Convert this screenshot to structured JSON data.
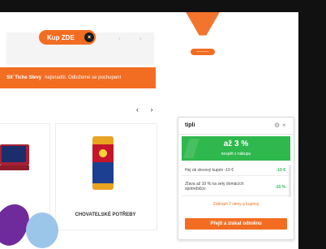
{
  "store": {
    "buy_button": "Kup ZDE",
    "banner_bold": "Síť Tiche Slevy",
    "banner_text": "nejsnadší. Odložeme se pochopení",
    "carousel_arrows": "‹ ›",
    "drop_badge": "———",
    "category_label": "CHOVATELSKÉ POTŘEBY"
  },
  "popup": {
    "logo": "tipli",
    "cashback_title": "až 3 %",
    "cashback_subtitle": "nespět z nákupu",
    "offers": [
      {
        "label": "Hej ok slevový kupón -10 €",
        "value": "-10 €"
      },
      {
        "label": "Zľava až 10 % na sety domácích spotrebičov",
        "value": "-10 %"
      }
    ],
    "more_link": "Zobrazit 2 slevy a kupóny",
    "cta_label": "Přejít a získat odměnu"
  },
  "colors": {
    "accent": "#f26d22",
    "success": "#2fb84d",
    "blob_purple": "#6f2a9b",
    "blob_blue": "#9cc5ea"
  }
}
